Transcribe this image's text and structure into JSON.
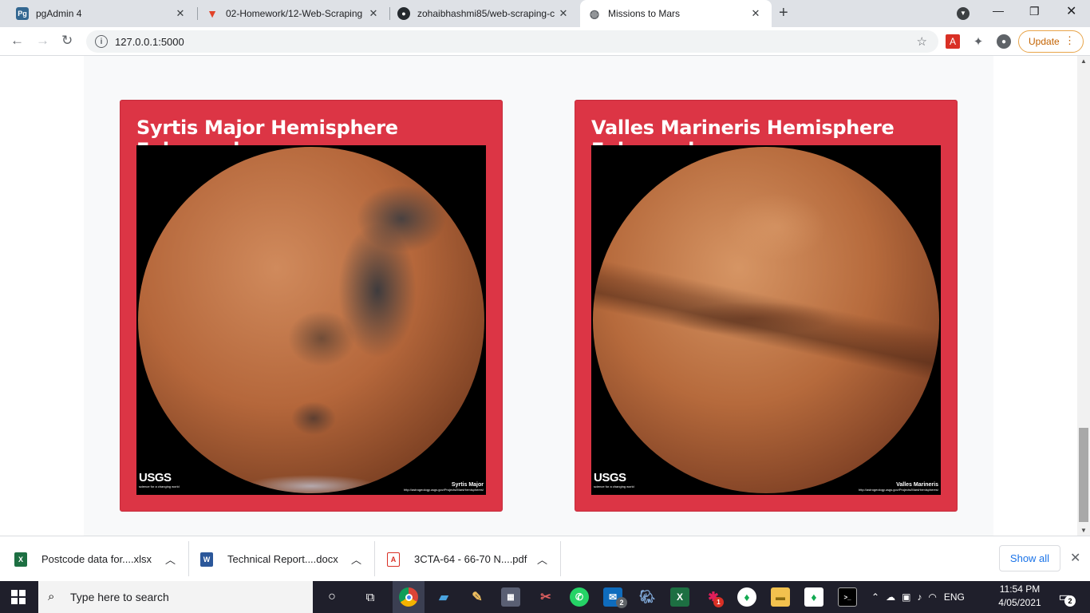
{
  "browser": {
    "tabs": [
      {
        "title": "pgAdmin 4",
        "favicon": "pgadmin-icon",
        "active": false
      },
      {
        "title": "02-Homework/12-Web-Scraping",
        "favicon": "gitlab-icon",
        "active": false
      },
      {
        "title": "zohaibhashmi85/web-scraping-c",
        "favicon": "github-icon",
        "active": false
      },
      {
        "title": "Missions to Mars",
        "favicon": "globe-icon",
        "active": true
      }
    ],
    "url": "127.0.0.1:5000",
    "update_label": "Update"
  },
  "page": {
    "hemispheres": [
      {
        "title": "Syrtis Major Hemisphere Enhanced",
        "logo": "USGS",
        "logo_sub": "science for a changing world",
        "caption": "Syrtis Major",
        "caption_url": "http://astrogeology.usgs.gov/Projects/MarsHemispheres/"
      },
      {
        "title": "Valles Marineris Hemisphere Enhanced",
        "logo": "USGS",
        "logo_sub": "science for a changing world",
        "caption": "Valles Marineris",
        "caption_url": "http://astrogeology.usgs.gov/Projects/MarsHemispheres/"
      }
    ],
    "accent_color": "#dc3545"
  },
  "downloads": {
    "items": [
      {
        "name": "Postcode data for....xlsx",
        "icon": "excel-icon"
      },
      {
        "name": "Technical Report....docx",
        "icon": "word-icon"
      },
      {
        "name": "3CTA-64 - 66-70 N....pdf",
        "icon": "pdf-icon"
      }
    ],
    "show_all": "Show all"
  },
  "taskbar": {
    "search_placeholder": "Type here to search",
    "language": "ENG",
    "time": "11:54 PM",
    "date": "4/05/2021",
    "notification_count": "2",
    "outlook_badge": "2",
    "slack_badge": "1"
  }
}
